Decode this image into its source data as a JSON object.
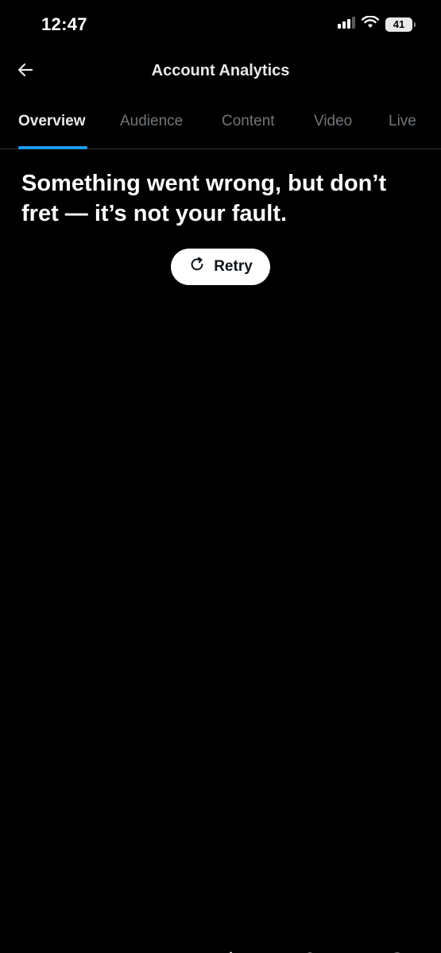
{
  "status_bar": {
    "time": "12:47",
    "battery": "41"
  },
  "header": {
    "title": "Account Analytics"
  },
  "tabs": [
    {
      "label": "Overview",
      "active": true
    },
    {
      "label": "Audience",
      "active": false
    },
    {
      "label": "Content",
      "active": false
    },
    {
      "label": "Video",
      "active": false
    },
    {
      "label": "Live",
      "active": false
    }
  ],
  "error": {
    "message": "Something went wrong, but don’t fret — it’s not your fault.",
    "retry_label": "Retry"
  },
  "bottom_nav": {
    "items": [
      "home-icon",
      "search-icon",
      "grok-icon",
      "notifications-icon",
      "messages-icon"
    ]
  },
  "colors": {
    "background": "#000000",
    "accent": "#1d9bf0",
    "text_primary": "#e7e9ea",
    "text_secondary": "#71767b"
  }
}
